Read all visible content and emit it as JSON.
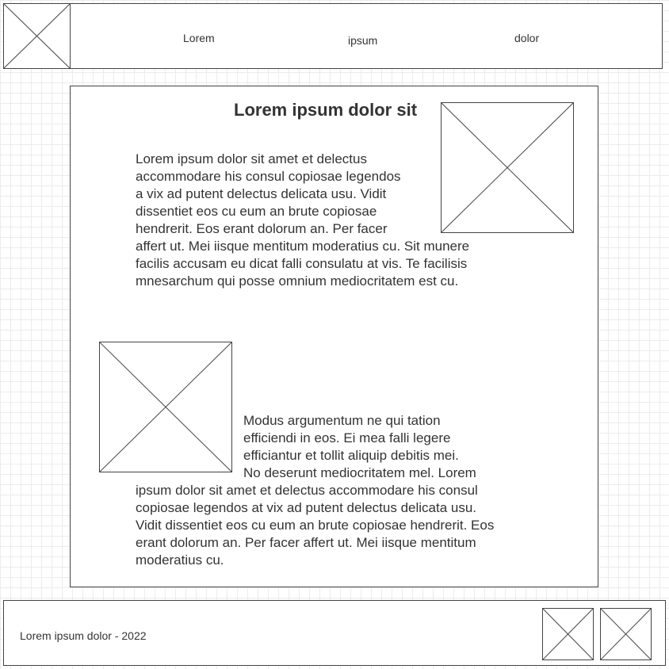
{
  "header": {
    "nav": [
      "Lorem",
      "ipsum",
      "dolor"
    ]
  },
  "main": {
    "title": "Lorem ipsum dolor sit",
    "paragraph_1_lines": [
      "Lorem ipsum dolor sit amet et delectus",
      "accommodare his consul copiosae legendos",
      "a vix ad putent delectus delicata usu. Vidit",
      "dissentiet eos cu eum an brute copiosae",
      "hendrerit. Eos erant dolorum an. Per facer",
      "affert ut. Mei iisque mentitum moderatius cu. Sit munere",
      "facilis accusam eu dicat falli consulatu at vis. Te facilisis",
      "mnesarchum qui posse omnium mediocritatem est cu."
    ],
    "paragraph_2_lines": [
      "Modus argumentum ne qui tation",
      "efficiendi in eos. Ei mea falli legere",
      "efficiantur et tollit aliquip debitis mei.",
      "No deserunt mediocritatem mel. Lorem",
      "ipsum dolor sit amet et delectus accommodare his consul",
      "copiosae legendos at vix ad putent delectus delicata usu.",
      "Vidit dissentiet eos cu eum an brute copiosae hendrerit. Eos",
      "erant dolorum an. Per facer affert ut. Mei iisque mentitum",
      "moderatius cu."
    ],
    "paragraph_2_indented_lines": 4
  },
  "footer": {
    "text": "Lorem ipsum dolor - 2022"
  },
  "placeholders": {
    "icon": "image-placeholder-icon"
  }
}
